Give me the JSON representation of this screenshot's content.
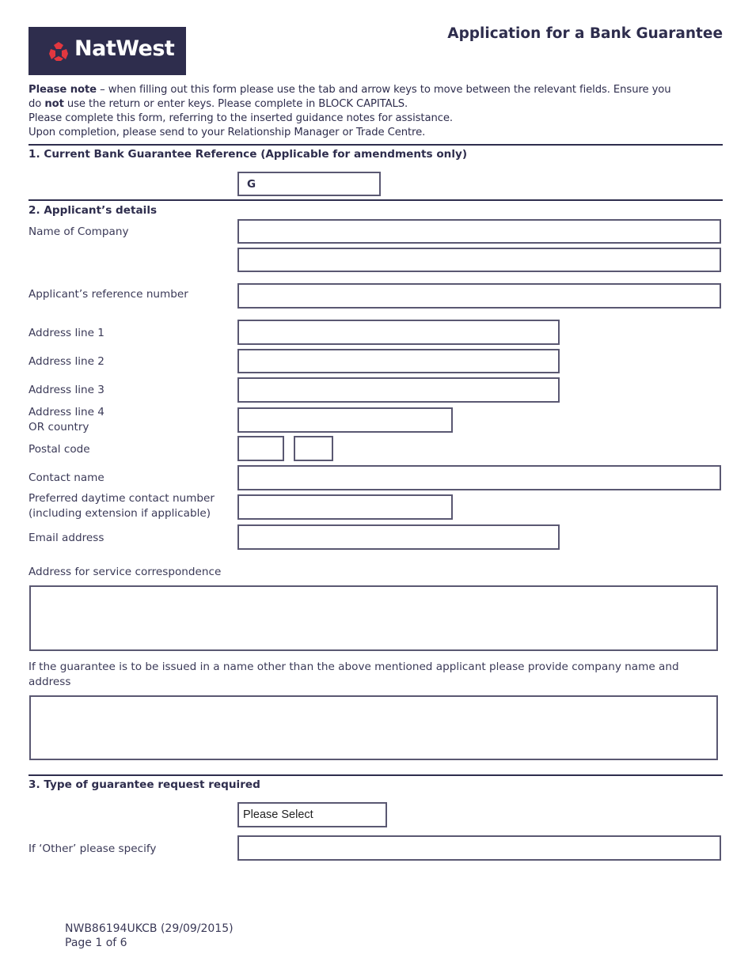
{
  "header": {
    "brand": "NatWest",
    "brand_icon": "natwest-cubes-icon",
    "brand_colors": {
      "background": "#2e2d4d",
      "icon": "#e2373f",
      "text": "#ffffff"
    },
    "title": "Application for a Bank Guarantee"
  },
  "notes": {
    "line1_bold": "Please note",
    "line1_rest": " – when filling out this form please use the tab and arrow keys to move between the relevant fields. Ensure you",
    "line2_pre": "do ",
    "line2_bold": "not",
    "line2_rest": " use the return or enter keys. Please complete in BLOCK CAPITALS.",
    "line3": "Please complete this form, referring to the inserted guidance notes for assistance.",
    "line4": "Upon completion, please send to your Relationship Manager or Trade Centre."
  },
  "section1": {
    "heading": "1. Current Bank Guarantee Reference (Applicable for amendments only)",
    "reference_value": "G"
  },
  "section2": {
    "heading": "2. Applicant’s details",
    "fields": {
      "company_name": {
        "label": "Name of Company",
        "value_line1": "",
        "value_line2": ""
      },
      "reference_number": {
        "label": "Applicant’s reference number",
        "value": ""
      },
      "address1": {
        "label": "Address line 1",
        "value": ""
      },
      "address2": {
        "label": "Address line 2",
        "value": ""
      },
      "address3": {
        "label": "Address line 3",
        "value": ""
      },
      "address4": {
        "label_line1": "Address line 4",
        "label_line2": "OR country",
        "value": ""
      },
      "postal_code": {
        "label": "Postal code",
        "value_part1": "",
        "value_part2": ""
      },
      "contact_name": {
        "label": "Contact name",
        "value": ""
      },
      "contact_number": {
        "label_line1": "Preferred daytime contact number",
        "label_line2": "(including extension if applicable)",
        "value": ""
      },
      "email": {
        "label": "Email address",
        "value": ""
      },
      "service_address": {
        "label": "Address for service correspondence",
        "value": ""
      },
      "other_name": {
        "label_line1": "If the guarantee is to be issued in a name other than the above mentioned applicant please provide company name and",
        "label_line2": "address",
        "value": ""
      }
    }
  },
  "section3": {
    "heading": "3. Type of guarantee request required",
    "type_select": {
      "selected": "Please Select"
    },
    "other_specify": {
      "label": "If ‘Other’ please specify",
      "value": ""
    }
  },
  "footer": {
    "form_code": "NWB86194UKCB (29/09/2015)",
    "page": "Page 1 of 6"
  }
}
